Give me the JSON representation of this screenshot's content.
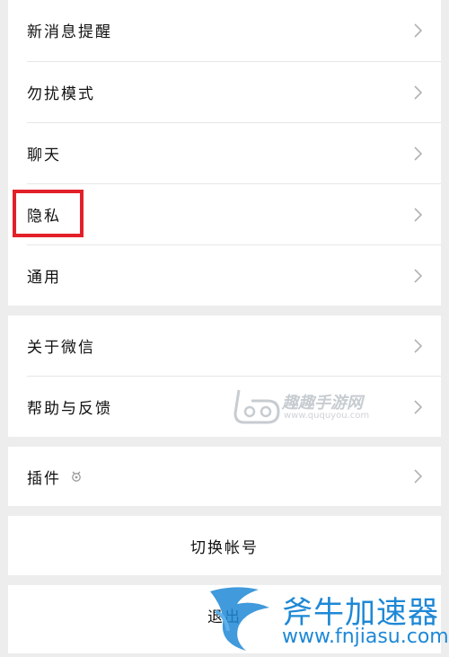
{
  "settings": {
    "group1": [
      {
        "label": "新消息提醒"
      },
      {
        "label": "勿扰模式"
      },
      {
        "label": "聊天"
      },
      {
        "label": "隐私"
      },
      {
        "label": "通用"
      }
    ],
    "group2": [
      {
        "label": "关于微信"
      },
      {
        "label": "帮助与反馈"
      }
    ],
    "group3": [
      {
        "label": "插件",
        "icon": "plugin-icon"
      }
    ]
  },
  "actions": {
    "switch_account": "切换帐号",
    "logout": "退出"
  },
  "watermarks": {
    "quqi": {
      "name": "趣趣手游网",
      "url": "www.ququyou.com"
    },
    "fnjiasu": {
      "name": "斧牛加速器",
      "url": "www.fnjiasu.com"
    }
  },
  "colors": {
    "highlight": "#e3202a",
    "background": "#ededed",
    "card": "#ffffff",
    "chevron": "#b2b2b2",
    "watermark_blue": "#1e88d6"
  }
}
